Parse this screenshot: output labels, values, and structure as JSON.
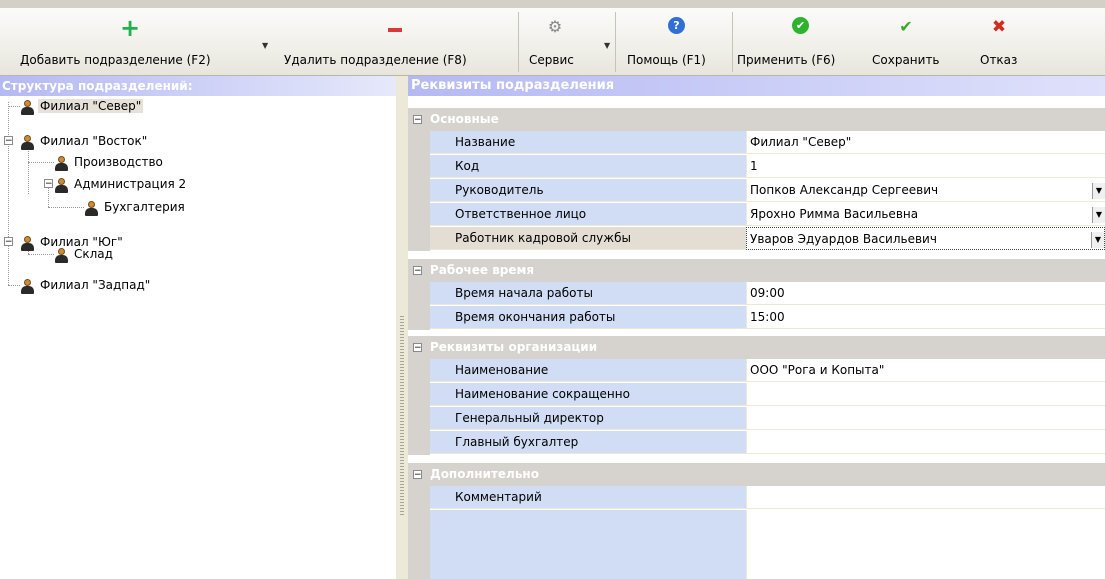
{
  "toolbar": {
    "add_label": "Добавить подразделение (F2)",
    "delete_label": "Удалить подразделение (F8)",
    "service_label": "Сервис",
    "help_label": "Помощь (F1)",
    "apply_label": "Применить (F6)",
    "save_label": "Сохранить",
    "cancel_label": "Отказ"
  },
  "tree": {
    "title": "Структура подразделений:",
    "nodes": [
      {
        "label": "Филиал \"Север\""
      },
      {
        "label": "Филиал \"Восток\""
      },
      {
        "label": "Производство"
      },
      {
        "label": "Администрация 2"
      },
      {
        "label": "Бухгалтерия"
      },
      {
        "label": "Филиал \"Юг\""
      },
      {
        "label": "Склад"
      },
      {
        "label": "Филиал \"Задпад\""
      }
    ]
  },
  "props": {
    "title": "Реквизиты подразделения",
    "categories": [
      {
        "label": "Основные"
      },
      {
        "label": "Рабочее время"
      },
      {
        "label": "Реквизиты организации"
      },
      {
        "label": "Дополнительно"
      }
    ],
    "rows": [
      {
        "name": "Название",
        "value": "Филиал \"Север\""
      },
      {
        "name": "Код",
        "value": "1"
      },
      {
        "name": "Руководитель",
        "value": "Попков Александр Сергеевич"
      },
      {
        "name": "Ответственное лицо",
        "value": "Ярохно Римма Васильевна"
      },
      {
        "name": "Работник кадровой службы",
        "value": "Уваров Эдуардов Васильевич"
      },
      {
        "name": "Время начала работы",
        "value": "09:00"
      },
      {
        "name": "Время окончания работы",
        "value": "15:00"
      },
      {
        "name": "Наименование",
        "value": "ООО \"Рога и Копыта\""
      },
      {
        "name": "Наименование сокращенно",
        "value": ""
      },
      {
        "name": "Генеральный директор",
        "value": ""
      },
      {
        "name": "Главный бухгалтер",
        "value": ""
      },
      {
        "name": "Комментарий",
        "value": ""
      }
    ]
  },
  "colors": {
    "add": "#22b14c",
    "delete": "#d83a3a",
    "help": "#2f6fd6",
    "apply": "#2fb32f",
    "save": "#3aa82a",
    "cancel": "#d42b1f"
  }
}
